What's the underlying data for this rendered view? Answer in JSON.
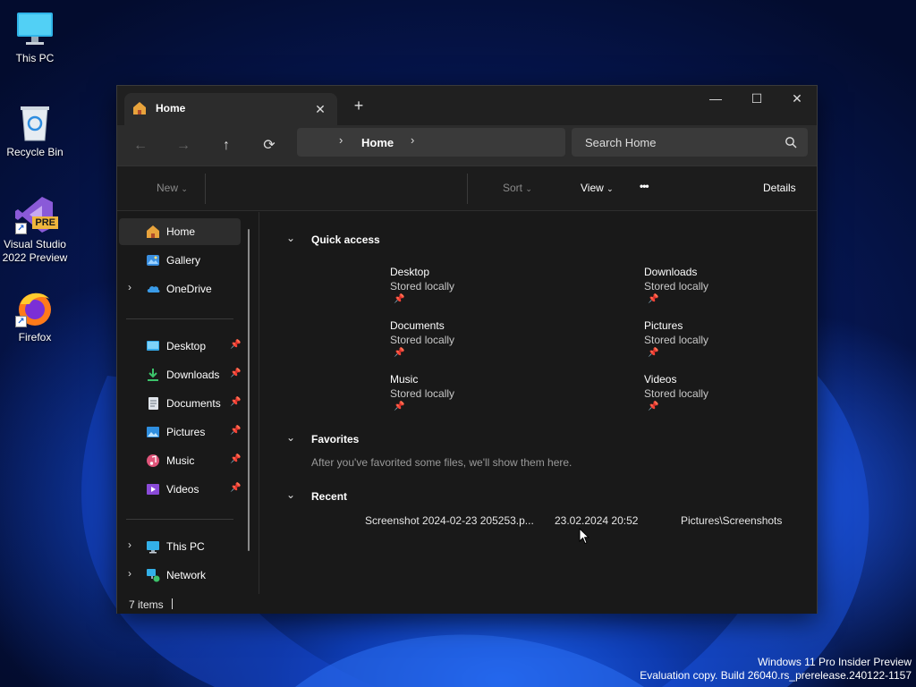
{
  "desktop": {
    "icons": [
      {
        "label": "This PC",
        "icon": "monitor-icon"
      },
      {
        "label": "Recycle Bin",
        "icon": "recycle-bin-icon"
      },
      {
        "label": "Visual Studio 2022 Preview",
        "icon": "visual-studio-icon",
        "badge": "PRE"
      },
      {
        "label": "Firefox",
        "icon": "firefox-icon"
      }
    ]
  },
  "window": {
    "tab": {
      "label": "Home",
      "close_glyph": "✕"
    },
    "new_tab_glyph": "+",
    "controls": {
      "minimize": "—",
      "maximize": "☐",
      "close": "✕"
    },
    "nav": {
      "back": "←",
      "forward": "→",
      "up": "↑",
      "refresh": "⟳"
    },
    "address": {
      "crumb": "Home"
    },
    "search": {
      "placeholder": "Search Home"
    },
    "toolbar": {
      "new_label": "New",
      "sort_label": "Sort",
      "view_label": "View",
      "more_glyph": "•••",
      "details_label": "Details"
    },
    "sidebar": {
      "items": [
        {
          "label": "Home",
          "icon": "home-icon",
          "selected": true
        },
        {
          "label": "Gallery",
          "icon": "gallery-icon"
        },
        {
          "label": "OneDrive",
          "icon": "cloud-icon",
          "expandable": true
        }
      ],
      "pinned": [
        {
          "label": "Desktop",
          "icon": "desktop-folder-icon"
        },
        {
          "label": "Downloads",
          "icon": "download-icon"
        },
        {
          "label": "Documents",
          "icon": "documents-icon"
        },
        {
          "label": "Pictures",
          "icon": "pictures-icon"
        },
        {
          "label": "Music",
          "icon": "music-icon"
        },
        {
          "label": "Videos",
          "icon": "videos-icon"
        }
      ],
      "locations": [
        {
          "label": "This PC",
          "icon": "monitor-icon"
        },
        {
          "label": "Network",
          "icon": "network-icon"
        }
      ]
    },
    "content": {
      "quick_access": {
        "title": "Quick access",
        "items": [
          {
            "name": "Desktop",
            "status": "Stored locally"
          },
          {
            "name": "Downloads",
            "status": "Stored locally"
          },
          {
            "name": "Documents",
            "status": "Stored locally"
          },
          {
            "name": "Pictures",
            "status": "Stored locally"
          },
          {
            "name": "Music",
            "status": "Stored locally"
          },
          {
            "name": "Videos",
            "status": "Stored locally"
          }
        ]
      },
      "favorites": {
        "title": "Favorites",
        "empty_note": "After you've favorited some files, we'll show them here."
      },
      "recent": {
        "title": "Recent",
        "rows": [
          {
            "name": "Screenshot 2024-02-23 205253.p...",
            "date": "23.02.2024 20:52",
            "location": "Pictures\\Screenshots"
          }
        ]
      }
    },
    "status": {
      "item_count": "7 items"
    }
  },
  "watermark": {
    "line1": "Windows 11 Pro Insider Preview",
    "line2": "Evaluation copy. Build 26040.rs_prerelease.240122-1157"
  },
  "colors": {
    "window_bg": "#191919",
    "titlebar_bg": "#202020",
    "control_bg": "#2c2c2c",
    "accent_home": "#e8a33c",
    "onedrive_blue": "#3a9be8"
  }
}
